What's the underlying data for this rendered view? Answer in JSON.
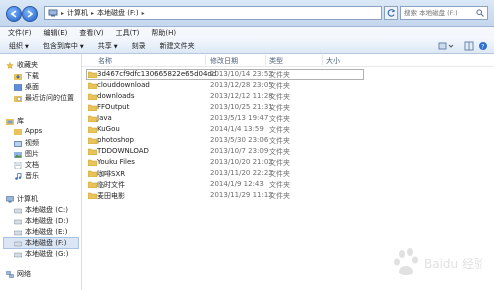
{
  "address": {
    "crumbs": [
      "计算机",
      "本地磁盘 (F:)"
    ]
  },
  "search": {
    "placeholder": "搜索 本地磁盘 (F:)"
  },
  "menu": [
    "文件(F)",
    "编辑(E)",
    "查看(V)",
    "工具(T)",
    "帮助(H)"
  ],
  "toolbar": {
    "organize": "组织",
    "include": "包含到库中",
    "share": "共享",
    "burn": "刻录",
    "new_folder": "新建文件夹"
  },
  "nav": {
    "favorites": "收藏夹",
    "fav_items": [
      "下载",
      "桌面",
      "最近访问的位置"
    ],
    "libraries": "库",
    "lib_items": [
      "Apps",
      "视频",
      "图片",
      "文档",
      "音乐"
    ],
    "computer": "计算机",
    "drives": [
      "本地磁盘 (C:)",
      "本地磁盘 (D:)",
      "本地磁盘 (E:)",
      "本地磁盘 (F:)",
      "本地磁盘 (G:)"
    ],
    "network": "网络"
  },
  "columns": {
    "name": "名称",
    "date": "修改日期",
    "type": "类型",
    "size": "大小"
  },
  "files": [
    {
      "name": "3d467cf9dfc130665822e65d04dd",
      "date": "2013/10/14 23:52",
      "type": "文件夹"
    },
    {
      "name": "clouddownload",
      "date": "2013/12/28 23:05",
      "type": "文件夹"
    },
    {
      "name": "downloads",
      "date": "2013/12/12 11:28",
      "type": "文件夹"
    },
    {
      "name": "FFOutput",
      "date": "2013/10/25 21:31",
      "type": "文件夹"
    },
    {
      "name": "Java",
      "date": "2013/5/13 19:47",
      "type": "文件夹"
    },
    {
      "name": "KuGou",
      "date": "2014/1/4 13:59",
      "type": "文件夹"
    },
    {
      "name": "photoshop",
      "date": "2013/5/30 23:06",
      "type": "文件夹"
    },
    {
      "name": "TDDOWNLOAD",
      "date": "2013/10/7 23:09",
      "type": "文件夹"
    },
    {
      "name": "Youku Files",
      "date": "2013/10/20 21:02",
      "type": "文件夹"
    },
    {
      "name": "咖啡SXR",
      "date": "2013/11/20 22:22",
      "type": "文件夹"
    },
    {
      "name": "临时文件",
      "date": "2014/1/9 12:43",
      "type": "文件夹"
    },
    {
      "name": "麦田电影",
      "date": "2013/11/29 11:12",
      "type": "文件夹"
    }
  ],
  "colors": {
    "folder": "#e8c25a",
    "selection": "#dbe6f4",
    "accent": "#1f5fc4"
  },
  "watermark": "Baidu 经验"
}
